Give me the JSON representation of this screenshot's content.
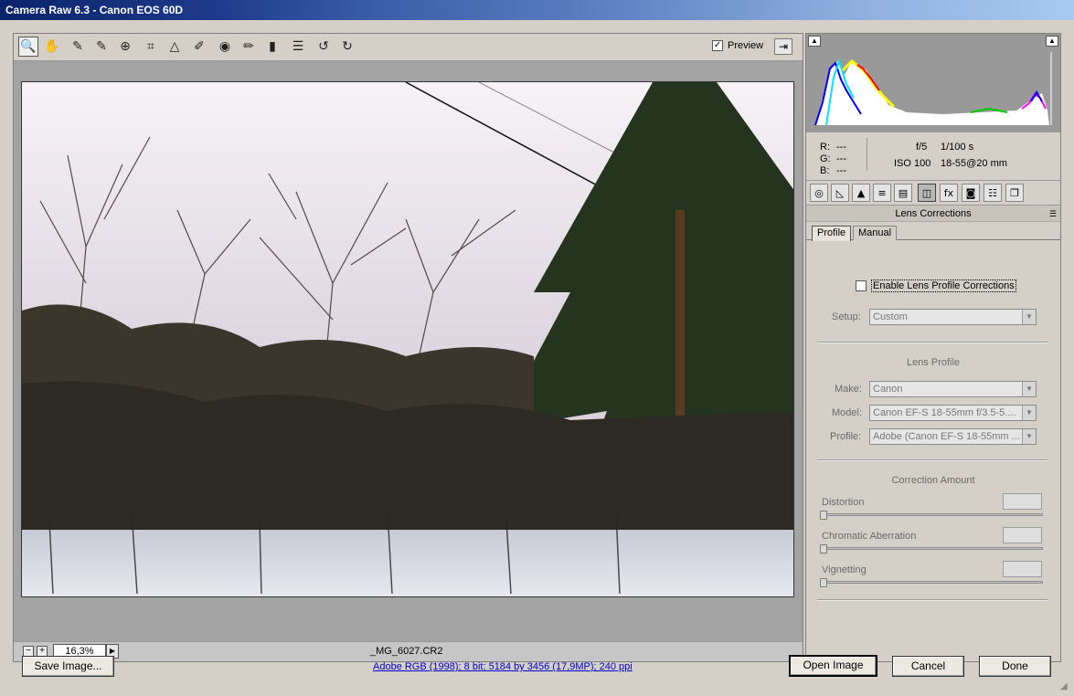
{
  "window": {
    "title": "Camera Raw 6.3  -  Canon EOS 60D"
  },
  "toolbar": {
    "tools": [
      {
        "name": "zoom-tool",
        "glyph": "🔍"
      },
      {
        "name": "hand-tool",
        "glyph": "✋"
      },
      {
        "name": "white-balance-tool",
        "glyph": "✎"
      },
      {
        "name": "color-sampler-tool",
        "glyph": "✎"
      },
      {
        "name": "targeted-adjustment-tool",
        "glyph": "⊕"
      },
      {
        "name": "crop-tool",
        "glyph": "⌗"
      },
      {
        "name": "straighten-tool",
        "glyph": "△"
      },
      {
        "name": "spot-removal-tool",
        "glyph": "✐"
      },
      {
        "name": "red-eye-tool",
        "glyph": "◉"
      },
      {
        "name": "adjustment-brush-tool",
        "glyph": "✏"
      },
      {
        "name": "graduated-filter-tool",
        "glyph": "▮"
      },
      {
        "name": "preferences-tool",
        "glyph": "☰"
      },
      {
        "name": "rotate-ccw-tool",
        "glyph": "↺"
      },
      {
        "name": "rotate-cw-tool",
        "glyph": "↻"
      }
    ],
    "preview_label": "Preview",
    "preview_checked": true,
    "fullscreen_glyph": "⇥"
  },
  "status": {
    "zoom": "16,3%",
    "filename": "_MG_6027.CR2"
  },
  "histogram": {
    "rgb": {
      "r": "---",
      "g": "---",
      "b": "---"
    },
    "r_label": "R:",
    "g_label": "G:",
    "b_label": "B:",
    "aperture": "f/5",
    "shutter": "1/100 s",
    "iso": "ISO 100",
    "lens": "18-55@20 mm"
  },
  "panel": {
    "title": "Lens Corrections",
    "tabs": [
      "Profile",
      "Manual"
    ],
    "active_tab": "Profile",
    "enable_label": "Enable Lens Profile Corrections",
    "enable_checked": false,
    "setup_label": "Setup:",
    "setup_value": "Custom",
    "lens_profile_heading": "Lens Profile",
    "make_label": "Make:",
    "make_value": "Canon",
    "model_label": "Model:",
    "model_value": "Canon EF-S 18-55mm f/3.5-5....",
    "profile_label": "Profile:",
    "profile_value": "Adobe (Canon EF-S 18-55mm ...",
    "correction_heading": "Correction Amount",
    "distortion_label": "Distortion",
    "chromatic_label": "Chromatic Aberration",
    "vignetting_label": "Vignetting"
  },
  "footer": {
    "save_label": "Save Image...",
    "workflow_link": "Adobe RGB (1998); 8 bit; 5184 by 3456 (17,9MP); 240 ppi",
    "open_label": "Open Image",
    "cancel_label": "Cancel",
    "done_label": "Done"
  },
  "panel_icons": [
    "◎",
    "◺",
    "▲",
    "≡",
    "▤",
    "◫",
    "fx",
    "◙",
    "☷",
    "❐"
  ]
}
